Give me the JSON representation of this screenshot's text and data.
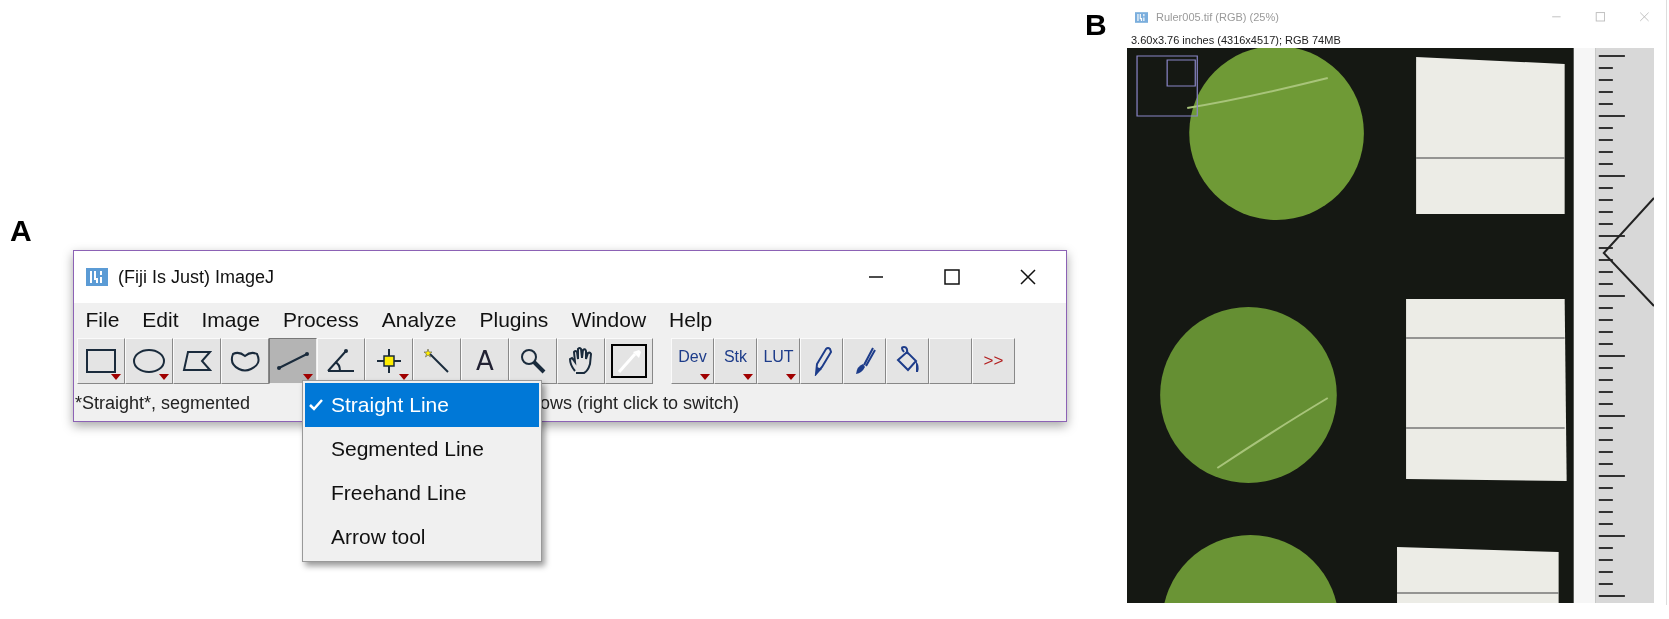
{
  "panel_a": {
    "label": "A",
    "window": {
      "title": "(Fiji Is Just) ImageJ",
      "menu": [
        "File",
        "Edit",
        "Image",
        "Process",
        "Analyze",
        "Plugins",
        "Window",
        "Help"
      ],
      "tools": [
        {
          "kind": "rectangle",
          "dropdown": true,
          "selected": false
        },
        {
          "kind": "oval",
          "dropdown": true,
          "selected": false
        },
        {
          "kind": "polygon",
          "dropdown": false,
          "selected": false
        },
        {
          "kind": "freehand",
          "dropdown": false,
          "selected": false
        },
        {
          "kind": "line",
          "dropdown": true,
          "selected": true
        },
        {
          "kind": "angle",
          "dropdown": false,
          "selected": false
        },
        {
          "kind": "point",
          "dropdown": true,
          "selected": false
        },
        {
          "kind": "wand",
          "dropdown": false,
          "selected": false
        },
        {
          "kind": "label",
          "label": "A",
          "dropdown": false,
          "selected": false
        },
        {
          "kind": "magnifier",
          "dropdown": false,
          "selected": false
        },
        {
          "kind": "hand",
          "dropdown": false,
          "selected": false
        },
        {
          "kind": "dropper",
          "dropdown": false,
          "selected": false
        }
      ],
      "extra_tools": [
        {
          "kind": "label",
          "label": "Dev",
          "dropdown": true
        },
        {
          "kind": "label",
          "label": "Stk",
          "dropdown": true
        },
        {
          "kind": "label",
          "label": "LUT",
          "dropdown": true
        },
        {
          "kind": "pencil",
          "dropdown": false
        },
        {
          "kind": "brush",
          "dropdown": false
        },
        {
          "kind": "bucket",
          "dropdown": false
        },
        {
          "kind": "blank",
          "dropdown": false
        },
        {
          "kind": "more",
          "label": ">>",
          "dropdown": false
        }
      ],
      "status": [
        "*Straight*, segmented",
        "ows (right click to switch)"
      ],
      "popup_menu": [
        {
          "label": "Straight Line",
          "selected": true
        },
        {
          "label": "Segmented Line",
          "selected": false
        },
        {
          "label": "Freehand Line",
          "selected": false
        },
        {
          "label": "Arrow tool",
          "selected": false
        }
      ]
    }
  },
  "panel_b": {
    "label": "B",
    "window": {
      "title": "Ruler005.tif (RGB) (25%)",
      "info": "3.60x3.76 inches (4316x4517); RGB 74MB"
    }
  }
}
